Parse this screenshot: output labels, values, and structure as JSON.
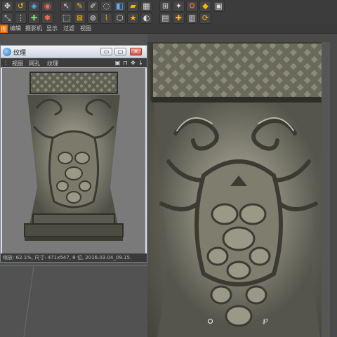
{
  "toolbar": {
    "row1_icons": [
      "move-icon",
      "undo-icon",
      "object-icon",
      "render-icon",
      "cursor-icon",
      "brush-icon",
      "pencil-icon",
      "smudge-icon",
      "fill-icon",
      "eraser-icon",
      "grid-icon",
      "lock-icon",
      "star-icon",
      "gear-icon"
    ],
    "row2_icons": [
      "scale-icon",
      "magnet-icon",
      "paint-icon",
      "material-icon",
      "select-icon",
      "stamp-icon",
      "bucket-icon",
      "dropper-icon",
      "shape-icon",
      "swatch-icon",
      "layer-icon",
      "plus-icon",
      "sun-icon"
    ]
  },
  "main_menu": {
    "tag": "图",
    "items": [
      "编辑",
      "摄影机",
      "显示",
      "过滤",
      "视图"
    ]
  },
  "texture_window": {
    "title": "纹理",
    "minimize_label": "▭",
    "maximize_label": "▢",
    "close_label": "✕",
    "menu_items": [
      "视图",
      "网孔",
      "纹理"
    ],
    "status_text": "缩放: 62.1%, 尺寸: 471x547, 8 位, 2016.03.04_09.15."
  },
  "colors": {
    "accent": "#e06a00",
    "stone_light": "#a9a896",
    "stone_dark": "#3b3b33"
  }
}
